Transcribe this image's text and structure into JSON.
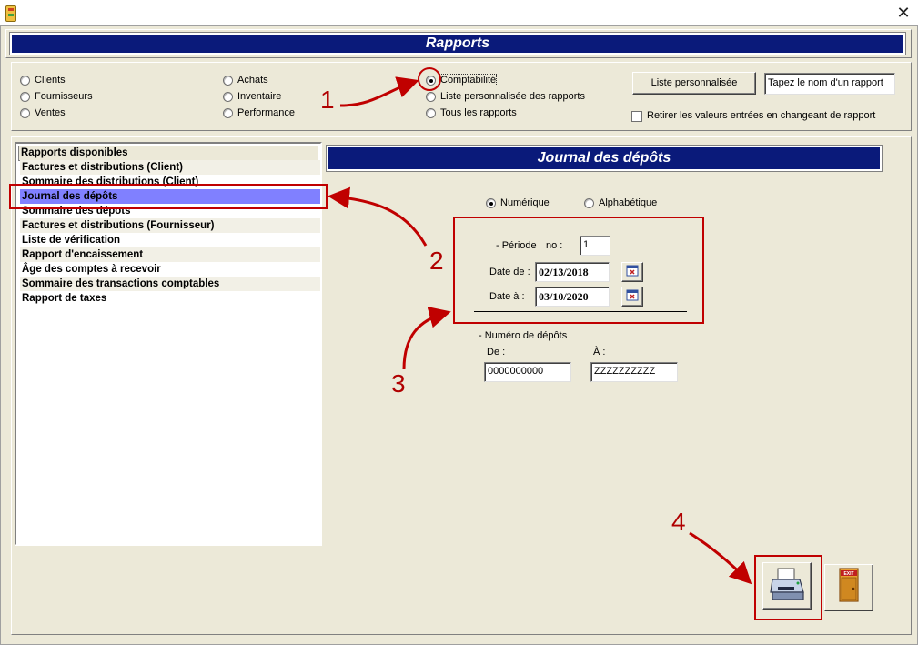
{
  "window": {
    "title_icon": "traffic-light-icon",
    "close_glyph": "✕"
  },
  "header": {
    "title": "Rapports"
  },
  "report_types": {
    "col1": [
      "Clients",
      "Fournisseurs",
      "Ventes"
    ],
    "col2": [
      "Achats",
      "Inventaire",
      "Performance"
    ],
    "col3": [
      "Comptabilité",
      "Liste personnalisée des rapports",
      "Tous les rapports"
    ],
    "selected": "Comptabilité"
  },
  "custom_list": {
    "button_label": "Liste personnalisée",
    "report_name_value": "Tapez le nom d'un rapport",
    "clear_checkbox_label": "Retirer les valeurs entrées en changeant de rapport"
  },
  "reports": {
    "header": "Rapports disponibles",
    "items": [
      "Factures et distributions (Client)",
      "Sommaire des distributions (Client)",
      "Journal des dépôts",
      "Sommaire des dépots",
      "Factures et distributions (Fournisseur)",
      "Liste de vérification",
      "Rapport d'encaissement",
      "Âge des comptes à recevoir",
      "Sommaire des transactions comptables",
      "Rapport de taxes"
    ],
    "selected_index": 2
  },
  "detail": {
    "title": "Journal des dépôts",
    "sort_numeric": "Numérique",
    "sort_alpha": "Alphabétique",
    "period_label": "- Période",
    "no_label": "no :",
    "period_no": "1",
    "date_from_label": "Date de :",
    "date_from": "02/13/2018",
    "date_to_label": "Date à :",
    "date_to": "03/10/2020",
    "deposit_label": "- Numéro de dépôts",
    "from_label": "De :",
    "to_label": "À :",
    "from_value": "0000000000",
    "to_value": "ZZZZZZZZZZ"
  },
  "annotations": {
    "n1": "1",
    "n2": "2",
    "n3": "3",
    "n4": "4"
  },
  "colors": {
    "banner": "#0a1a7a",
    "selection": "#8080ff",
    "annotation": "#c00000",
    "background": "#ece9d8"
  }
}
